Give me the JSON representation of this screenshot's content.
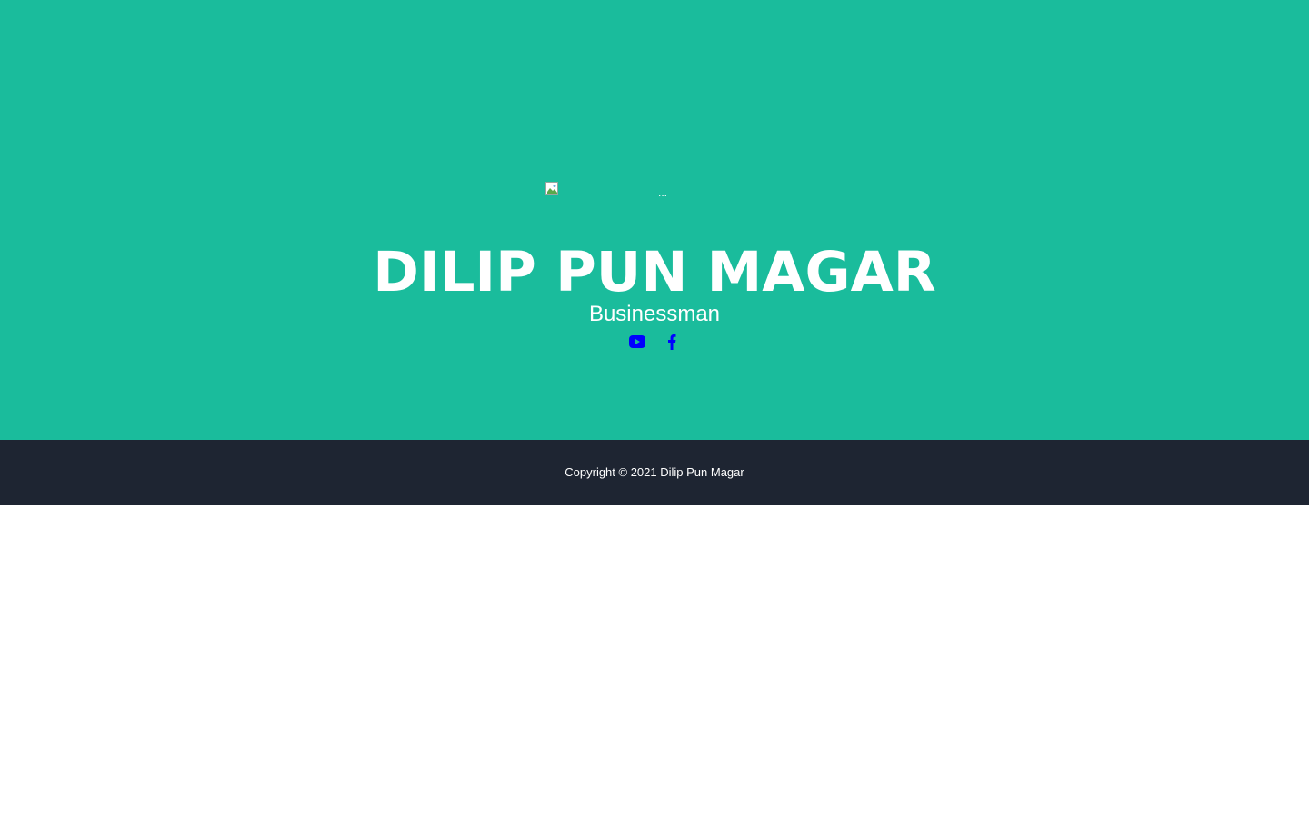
{
  "masthead": {
    "avatar_alt": "...",
    "title": "DILIP PUN MAGAR",
    "subtitle": "Businessman",
    "social": [
      {
        "name": "youtube-icon"
      },
      {
        "name": "facebook-icon"
      }
    ],
    "link_color": "#0000ff",
    "background_color": "#1abc9c"
  },
  "footer": {
    "copyright": "Copyright © 2021 Dilip Pun Magar",
    "background_color": "#1e2532"
  }
}
